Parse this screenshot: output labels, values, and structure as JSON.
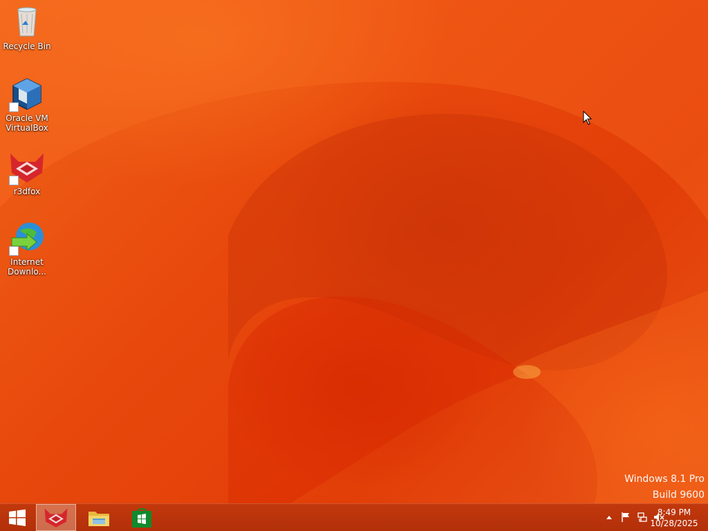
{
  "desktop": {
    "icons": [
      {
        "name": "recycle-bin",
        "label": "Recycle Bin",
        "icon": "recycle-bin-icon",
        "shortcut": false
      },
      {
        "name": "virtualbox",
        "label": "Oracle VM VirtualBox",
        "icon": "virtualbox-icon",
        "shortcut": true
      },
      {
        "name": "r3dfox",
        "label": "r3dfox",
        "icon": "r3dfox-icon",
        "shortcut": true
      },
      {
        "name": "internet-download-manager",
        "label": "Internet Downlo...",
        "icon": "idm-icon",
        "shortcut": true
      }
    ],
    "watermark": {
      "line1": "Windows 8.1 Pro",
      "line2": "Build 9600"
    }
  },
  "taskbar": {
    "start_icon": "windows-start-icon",
    "pinned": [
      {
        "name": "r3dfox",
        "icon": "r3dfox-icon",
        "active": true
      },
      {
        "name": "file-explorer",
        "icon": "folder-icon",
        "active": false
      },
      {
        "name": "store",
        "icon": "store-icon",
        "active": false
      }
    ],
    "tray": {
      "icons": [
        "show-hidden-icons-icon",
        "action-center-flag-icon",
        "network-icon",
        "volume-muted-icon"
      ],
      "time": "8:49 PM",
      "date": "10/28/2025"
    }
  },
  "colors": {
    "wallpaper_base": "#e8480c",
    "taskbar": "#b8330b",
    "label_text": "#ffffff"
  }
}
